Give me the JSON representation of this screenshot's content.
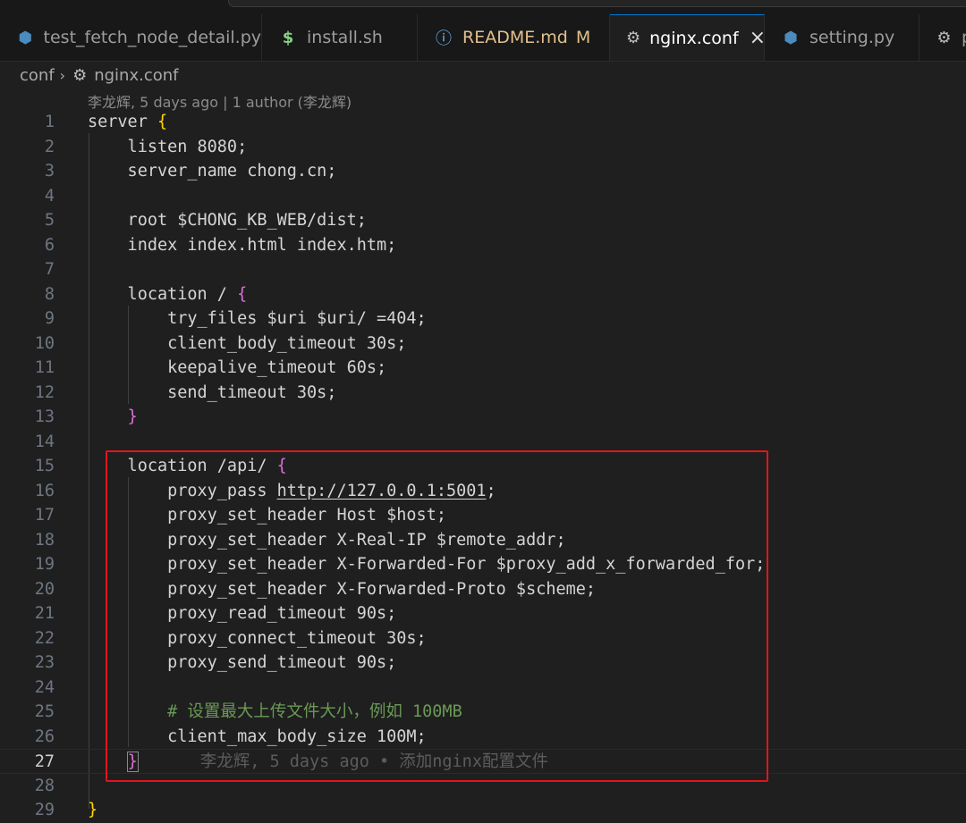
{
  "tabs": [
    {
      "label": "test_fetch_node_detail.py",
      "icon": "python-icon",
      "modified": "",
      "active": false
    },
    {
      "label": "install.sh",
      "icon": "shell-icon",
      "modified": "",
      "active": false
    },
    {
      "label": "README.md",
      "icon": "info-icon",
      "modified": "M",
      "active": false
    },
    {
      "label": "nginx.conf",
      "icon": "gear-icon",
      "modified": "",
      "active": true
    },
    {
      "label": "setting.py",
      "icon": "python-icon",
      "modified": "",
      "active": false
    },
    {
      "label": "p",
      "icon": "gear-icon",
      "modified": "",
      "active": false
    }
  ],
  "breadcrumb": {
    "folder": "conf",
    "file": "nginx.conf"
  },
  "codelens": "李龙辉, 5 days ago | 1 author (李龙辉)",
  "blame": "李龙辉, 5 days ago • 添加nginx配置文件",
  "highlight_color": "#e0141e",
  "lines": [
    {
      "n": "1",
      "segs": [
        [
          "server ",
          "kw"
        ],
        [
          "{",
          "br"
        ]
      ]
    },
    {
      "n": "2",
      "segs": [
        [
          "    listen 8080;",
          "kw"
        ]
      ]
    },
    {
      "n": "3",
      "segs": [
        [
          "    server_name chong.cn;",
          "kw"
        ]
      ]
    },
    {
      "n": "4",
      "segs": []
    },
    {
      "n": "5",
      "segs": [
        [
          "    root $CHONG_KB_WEB/dist;",
          "kw"
        ]
      ]
    },
    {
      "n": "6",
      "segs": [
        [
          "    index index.html index.htm;",
          "kw"
        ]
      ]
    },
    {
      "n": "7",
      "segs": []
    },
    {
      "n": "8",
      "segs": [
        [
          "    location / ",
          "kw"
        ],
        [
          "{",
          "br2"
        ]
      ]
    },
    {
      "n": "9",
      "segs": [
        [
          "        try_files $uri $uri/ =404;",
          "kw"
        ]
      ]
    },
    {
      "n": "10",
      "segs": [
        [
          "        client_body_timeout 30s;",
          "kw"
        ]
      ]
    },
    {
      "n": "11",
      "segs": [
        [
          "        keepalive_timeout 60s;",
          "kw"
        ]
      ]
    },
    {
      "n": "12",
      "segs": [
        [
          "        send_timeout 30s;",
          "kw"
        ]
      ]
    },
    {
      "n": "13",
      "segs": [
        [
          "    ",
          "kw"
        ],
        [
          "}",
          "br2"
        ]
      ]
    },
    {
      "n": "14",
      "segs": []
    },
    {
      "n": "15",
      "segs": [
        [
          "    location /api/ ",
          "kw"
        ],
        [
          "{",
          "br2"
        ]
      ]
    },
    {
      "n": "16",
      "segs": [
        [
          "        proxy_pass ",
          "kw"
        ],
        [
          "http://127.0.0.1:5001",
          "url"
        ],
        [
          ";",
          "kw"
        ]
      ]
    },
    {
      "n": "17",
      "segs": [
        [
          "        proxy_set_header Host $host;",
          "kw"
        ]
      ]
    },
    {
      "n": "18",
      "segs": [
        [
          "        proxy_set_header X-Real-IP $remote_addr;",
          "kw"
        ]
      ]
    },
    {
      "n": "19",
      "segs": [
        [
          "        proxy_set_header X-Forwarded-For $proxy_add_x_forwarded_for;",
          "kw"
        ]
      ]
    },
    {
      "n": "20",
      "segs": [
        [
          "        proxy_set_header X-Forwarded-Proto $scheme;",
          "kw"
        ]
      ]
    },
    {
      "n": "21",
      "segs": [
        [
          "        proxy_read_timeout 90s;",
          "kw"
        ]
      ]
    },
    {
      "n": "22",
      "segs": [
        [
          "        proxy_connect_timeout 30s;",
          "kw"
        ]
      ]
    },
    {
      "n": "23",
      "segs": [
        [
          "        proxy_send_timeout 90s;",
          "kw"
        ]
      ]
    },
    {
      "n": "24",
      "segs": []
    },
    {
      "n": "25",
      "segs": [
        [
          "        # 设置最大上传文件大小，例如 100MB",
          "cmt"
        ]
      ]
    },
    {
      "n": "26",
      "segs": [
        [
          "        client_max_body_size 100M;",
          "kw"
        ]
      ]
    },
    {
      "n": "27",
      "segs": [
        [
          "    ",
          "kw"
        ],
        [
          "}",
          "br2"
        ]
      ],
      "current": true
    },
    {
      "n": "28",
      "segs": []
    },
    {
      "n": "29",
      "segs": [
        [
          "}",
          "br"
        ]
      ]
    }
  ]
}
